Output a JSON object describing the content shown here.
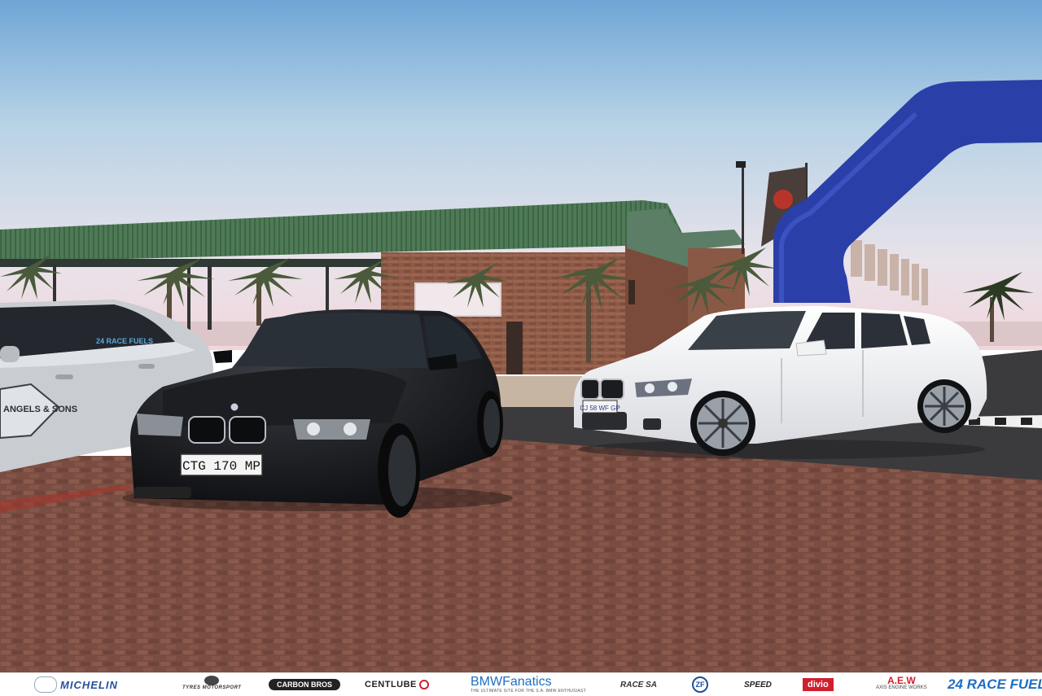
{
  "photo": {
    "black_car_plate": "CTG 170 MP",
    "white_car_plate": "CJ 58 WF GP",
    "silver_car_door_logo": "ANGELS & SONS",
    "silver_car_window_logo": "24 RACE FUELS"
  },
  "sponsors": [
    {
      "id": "michelin",
      "text": "MICHELIN"
    },
    {
      "id": "tyres-motorsport",
      "text": "TYRES MOTORSPORT"
    },
    {
      "id": "carbon-bros",
      "text": "CARBON BROS"
    },
    {
      "id": "centlube",
      "text": "CENTLUBE"
    },
    {
      "id": "bmw-fanatics",
      "text": "BMWFanatics",
      "subtext": "THE ULTIMATE SITE FOR THE S.A. BMW ENTHUSIAST"
    },
    {
      "id": "race-sa",
      "text": "RACE SA"
    },
    {
      "id": "zf",
      "text": "ZF"
    },
    {
      "id": "speed-sound",
      "text": "SPEED"
    },
    {
      "id": "divio",
      "text": "divio"
    },
    {
      "id": "aew",
      "text": "A.E.W",
      "subtext": "AXIS ENGINE WORKS"
    },
    {
      "id": "24-race-fuels",
      "text": "24 RACE FUELS"
    }
  ],
  "colors": {
    "sky_top": "#6fa6d6",
    "sky_bottom": "#f1d6dc",
    "roof_green": "#4e7a56",
    "brick": "#8d5a46",
    "paving": "#7a4d42",
    "arch_blue": "#2a3fa8",
    "black_car": "#111215",
    "white_car": "#f3f3f4"
  }
}
